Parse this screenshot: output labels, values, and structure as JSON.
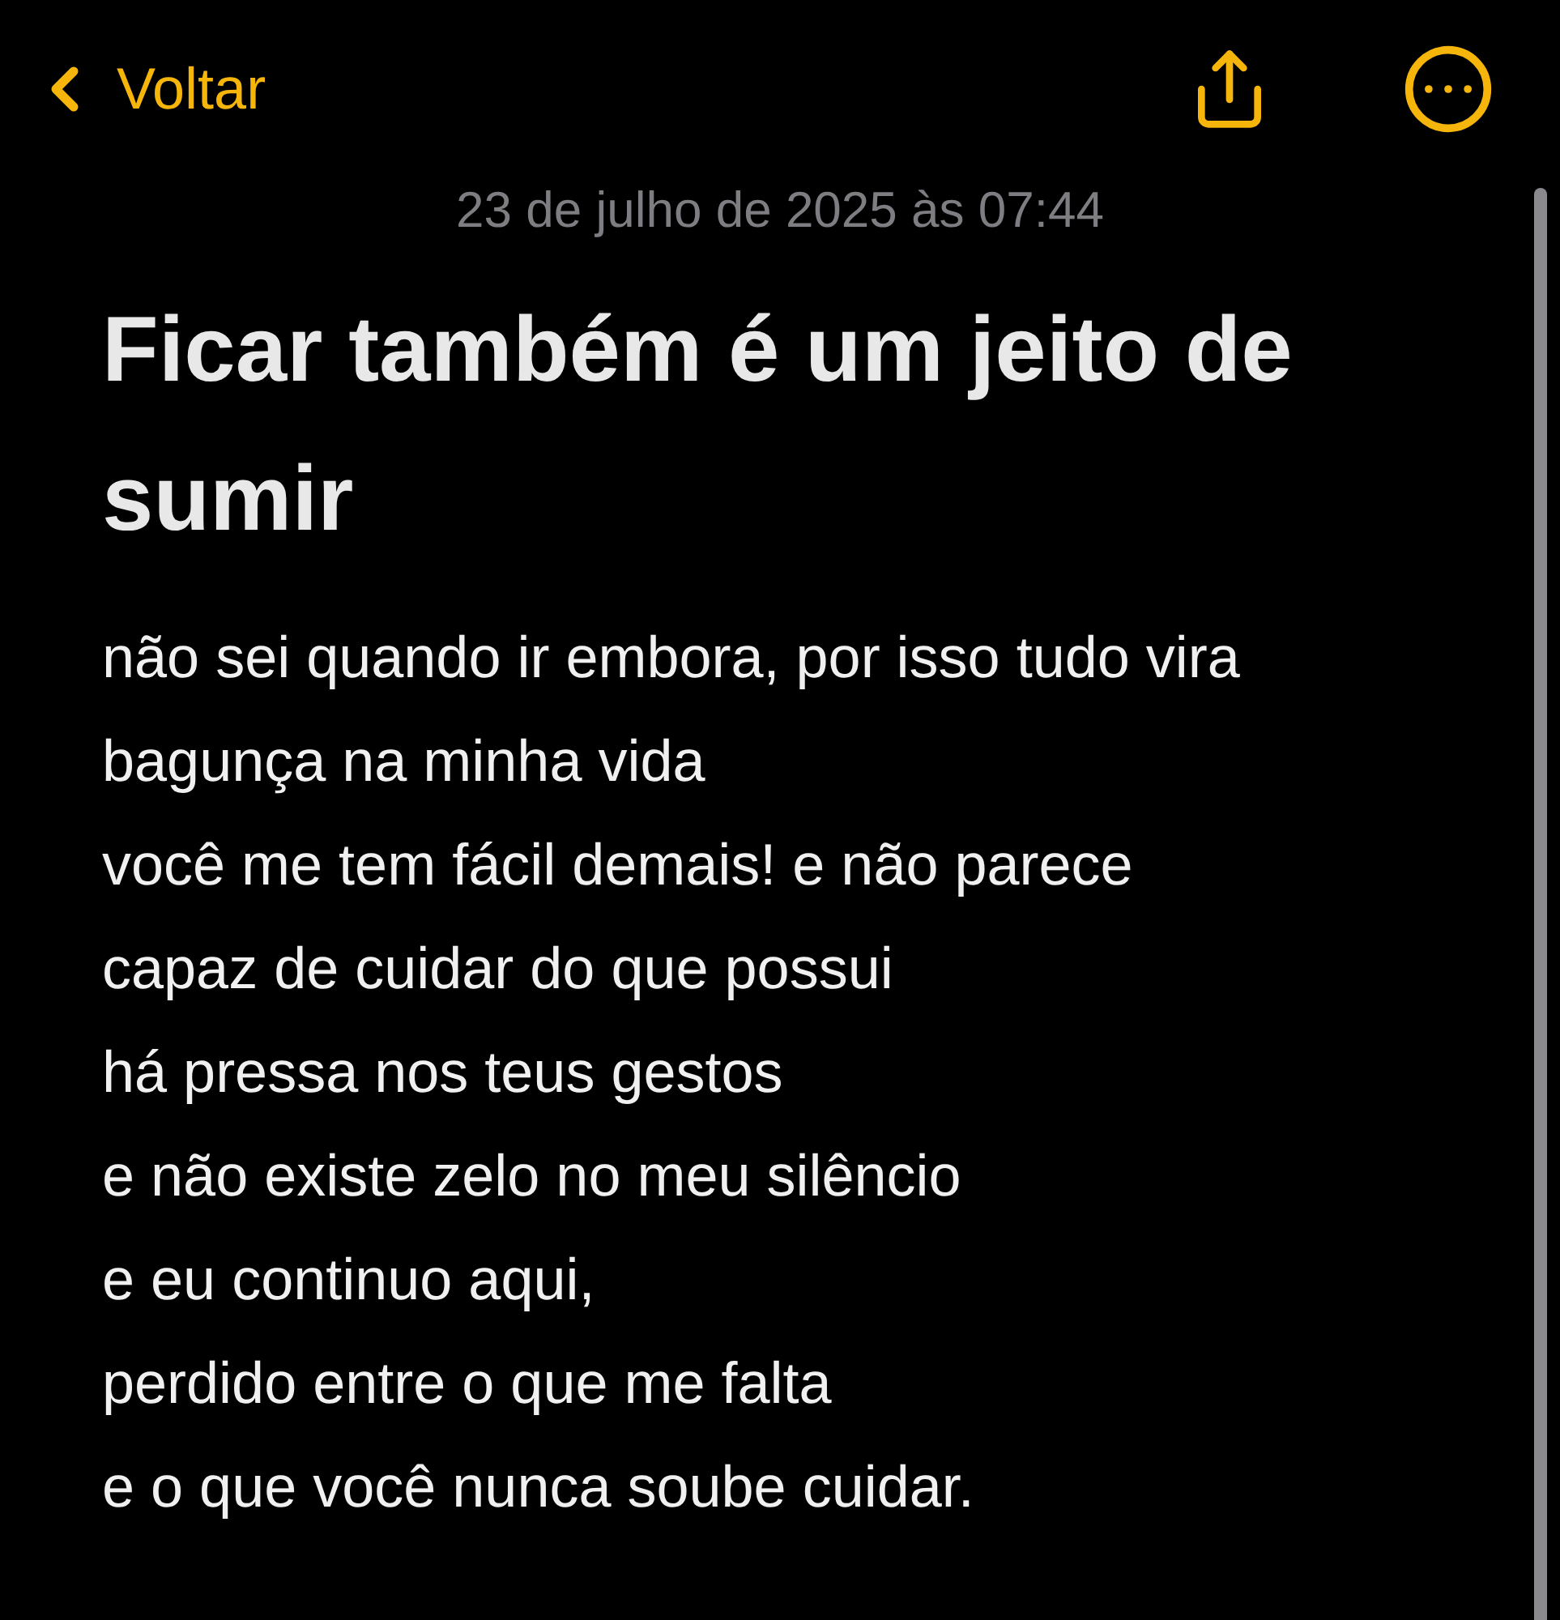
{
  "nav": {
    "back_label": "Voltar"
  },
  "note": {
    "date": "23 de julho de 2025 às 07:44",
    "title": "Ficar também é um jeito de sumir",
    "body_lines": [
      "não sei quando ir embora, por isso tudo vira",
      "bagunça na minha vida",
      "você me tem fácil demais! e não parece",
      "capaz de cuidar do que possui",
      "há pressa nos teus gestos",
      "e não existe zelo no meu silêncio",
      "e eu continuo aqui,",
      "perdido entre o que me falta",
      "e o que você nunca soube cuidar."
    ]
  }
}
